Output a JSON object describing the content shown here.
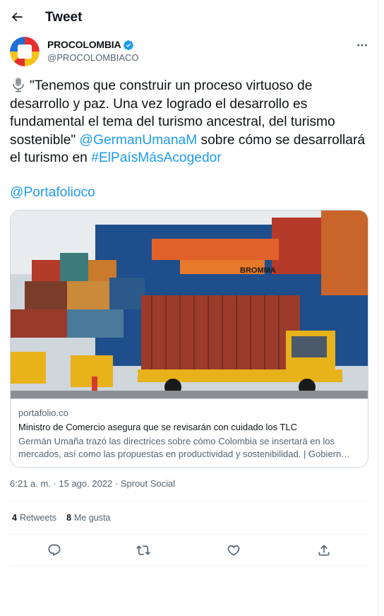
{
  "header": {
    "title": "Tweet",
    "back_icon": "arrow-left-icon"
  },
  "author": {
    "name": "PROCOLOMBIA",
    "handle": "@PROCOLOMBIACO",
    "verified": true,
    "avatar_colors": [
      "#1f6fd6",
      "#e52f2f",
      "#f7c31a"
    ]
  },
  "tweet": {
    "text_icon": "microphone-icon",
    "text_part1": "\"Tenemos que construir un proceso virtuoso de desarrollo y paz. Una vez logrado el desarrollo es fundamental el tema del turismo ancestral, del turismo sostenible\" ",
    "mention1": "@GermanUmanaM",
    "text_part2": " sobre cómo se desarrollará el turismo en ",
    "hashtag": "#ElPaísMásAcogedor",
    "mention2": "@Portafolioco"
  },
  "card": {
    "domain": "portafolio.co",
    "title": "Ministro de Comercio asegura que se revisarán con cuidado los TLC",
    "description": "Germán Umaña trazó las directrices sobre cómo Colombia se insertará en los mercados, así como las propuestas en productividad y sostenibilidad. | Gobiern…",
    "image_text": "BROMMA"
  },
  "meta": {
    "time": "6:21 a. m.",
    "separator": " · ",
    "date": "15 ago. 2022",
    "source": "Sprout Social"
  },
  "stats": {
    "retweets_count": "4",
    "retweets_label": "Retweets",
    "likes_count": "8",
    "likes_label": "Me gusta"
  },
  "actions": [
    "reply-icon",
    "retweet-icon",
    "like-icon",
    "share-icon"
  ],
  "colors": {
    "link": "#1d9bf0",
    "text": "#0f1419",
    "secondary": "#536471",
    "border": "#cfd9de"
  }
}
